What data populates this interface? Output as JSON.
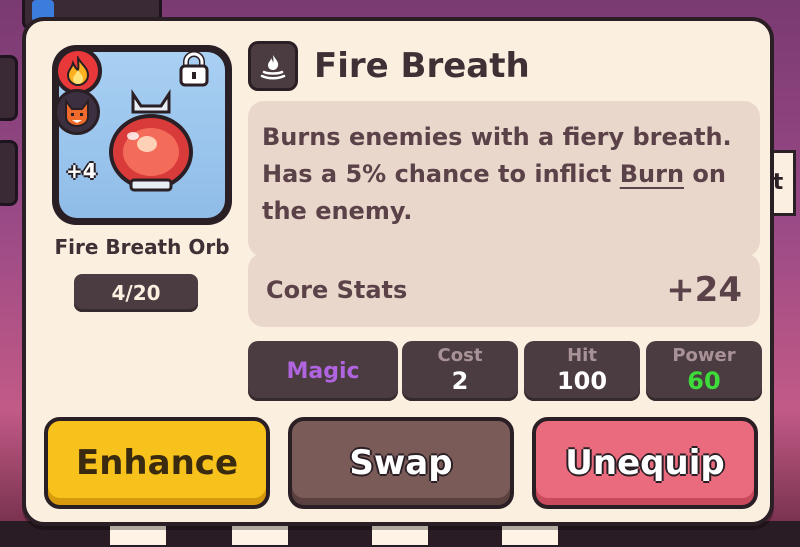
{
  "colors": {
    "card_bg": "#fbefe0",
    "dark_outline": "#2a1f24",
    "enhance_yellow": "#f7c21b",
    "swap_brown": "#7b5b58",
    "unequip_pink": "#ea6b7d",
    "magic_purple": "#b064e0",
    "power_green": "#3ddc3a"
  },
  "item": {
    "name": "Fire Breath Orb",
    "level_text": "4/20",
    "plus_level": "+4",
    "element_icon": "fire-element-icon",
    "pet_icon": "fox-pet-icon",
    "lock_icon": "lock-icon",
    "image_icon": "red-orb-icon"
  },
  "skill": {
    "icon": "fire-breath-skill-icon",
    "title": "Fire Breath",
    "description_before": "Burns enemies with a fiery breath. Has a 5% chance to inflict ",
    "description_link": "Burn",
    "description_after": " on the enemy."
  },
  "core_stats": {
    "label": "Core Stats",
    "value": "+24"
  },
  "stats": {
    "type": "Magic",
    "cost_label": "Cost",
    "cost_value": "2",
    "hit_label": "Hit",
    "hit_value": "100",
    "power_label": "Power",
    "power_value": "60"
  },
  "buttons": {
    "enhance": "Enhance",
    "swap": "Swap",
    "unequip": "Unequip"
  }
}
